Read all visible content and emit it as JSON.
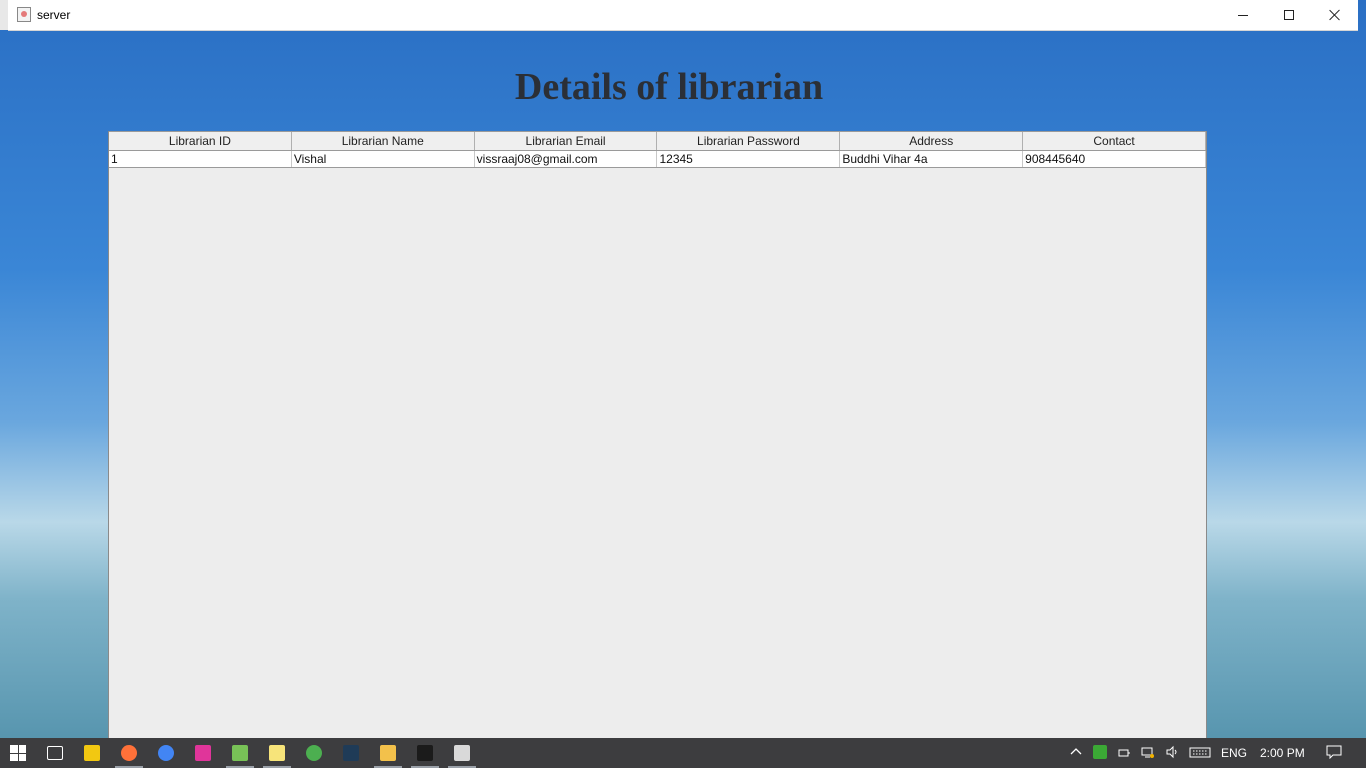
{
  "window": {
    "title": "server",
    "minimize_label": "",
    "maximize_label": "",
    "close_label": ""
  },
  "page": {
    "heading": "Details of librarian"
  },
  "table": {
    "columns": [
      "Librarian ID",
      "Librarian Name",
      "Librarian Email",
      "Librarian Password",
      "Address",
      "Contact"
    ],
    "rows": [
      [
        "1",
        "Vishal",
        "vissraaj08@gmail.com",
        "12345",
        "Buddhi Vihar 4a",
        "908445640"
      ]
    ]
  },
  "taskbar": {
    "apps": [
      {
        "icon": "task-view-icon",
        "color": "#ffffff"
      },
      {
        "icon": "sticky-notes-icon",
        "color": "#f2c811"
      },
      {
        "icon": "firefox-icon",
        "color": "#ff7139"
      },
      {
        "icon": "chrome-icon",
        "color": "#4285f4"
      },
      {
        "icon": "app-pink-icon",
        "color": "#e0359a"
      },
      {
        "icon": "android-studio-icon",
        "color": "#78c257"
      },
      {
        "icon": "notepad-icon",
        "color": "#f7e47a"
      },
      {
        "icon": "eclipse-icon",
        "color": "#4caf50"
      },
      {
        "icon": "app-dark-icon",
        "color": "#1f3b57"
      },
      {
        "icon": "file-explorer-icon",
        "color": "#f3c14b"
      },
      {
        "icon": "command-prompt-icon",
        "color": "#1b1b1b"
      },
      {
        "icon": "java-icon",
        "color": "#d9d9d9"
      }
    ],
    "tray": {
      "language": "ENG",
      "time": "2:00 PM"
    }
  }
}
